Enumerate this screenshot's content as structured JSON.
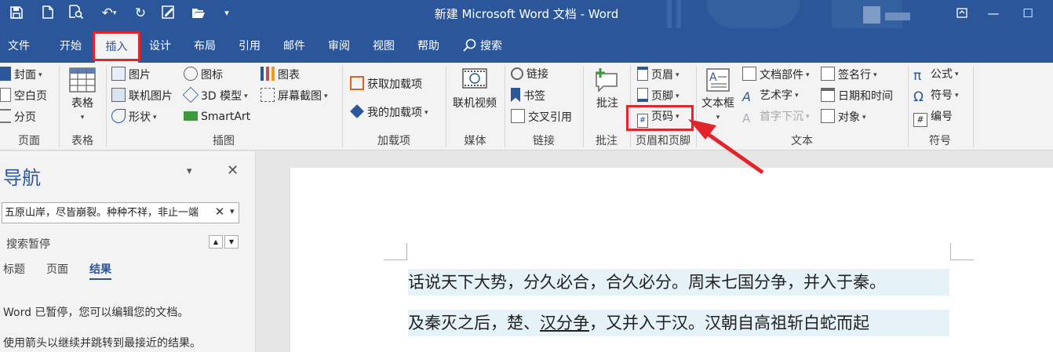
{
  "window": {
    "title": "新建 Microsoft Word 文档 - Word",
    "qat": [
      "save-icon",
      "new-document-icon",
      "print-preview-icon",
      "undo-icon",
      "redo-icon",
      "edit-icon",
      "open-folder-icon",
      "customize-qat-icon"
    ]
  },
  "tabs": {
    "file": "文件",
    "home": "开始",
    "insert": "插入",
    "design": "设计",
    "layout": "布局",
    "references": "引用",
    "mailings": "邮件",
    "review": "审阅",
    "view": "视图",
    "help": "帮助",
    "search": "搜索"
  },
  "ribbon": {
    "pages": {
      "cover": "封面",
      "blank": "空白页",
      "break": "分页",
      "label": "页面"
    },
    "tables": {
      "table": "表格",
      "label": "表格"
    },
    "illustrations": {
      "pictures": "图片",
      "online_pictures": "联机图片",
      "shapes": "形状",
      "icons": "图标",
      "model3d": "3D 模型",
      "smartart": "SmartArt",
      "chart": "图表",
      "screenshot": "屏幕截图",
      "label": "插图"
    },
    "addins": {
      "get": "获取加载项",
      "my": "我的加载项",
      "label": "加载项"
    },
    "media": {
      "online_video": "联机视频",
      "label": "媒体"
    },
    "links": {
      "link": "链接",
      "bookmark": "书签",
      "cross_ref": "交叉引用",
      "label": "链接"
    },
    "comments": {
      "comment": "批注",
      "label": "批注"
    },
    "header_footer": {
      "header": "页眉",
      "footer": "页脚",
      "page_number": "页码",
      "label": "页眉和页脚"
    },
    "text": {
      "textbox": "文本框",
      "quick_parts": "文档部件",
      "wordart": "艺术字",
      "drop_cap": "首字下沉",
      "signature": "签名行",
      "datetime": "日期和时间",
      "object": "对象",
      "label": "文本"
    },
    "symbols": {
      "equation": "公式",
      "symbol": "符号",
      "number": "编号",
      "label": "符号"
    }
  },
  "nav": {
    "title": "导航",
    "search_value": "五原山岸，尽皆崩裂。种种不祥，非止一端",
    "status": "搜索暂停",
    "tabs": [
      "标题",
      "页面",
      "结果"
    ],
    "msg1": "Word 已暂停，您可以编辑您的文档。",
    "msg2": "使用箭头以继续并跳转到最接近的结果。"
  },
  "document": {
    "line1": "话说天下大势，分久必合，合久必分。周末七国分争，并入于秦。",
    "line2a": "及秦灭之后，楚、",
    "line2b": "汉分争",
    "line2c": "，又并入于汉。汉朝自高祖斩白蛇而起"
  },
  "colors": {
    "accent": "#2b579a",
    "highlight": "#e3242b"
  }
}
